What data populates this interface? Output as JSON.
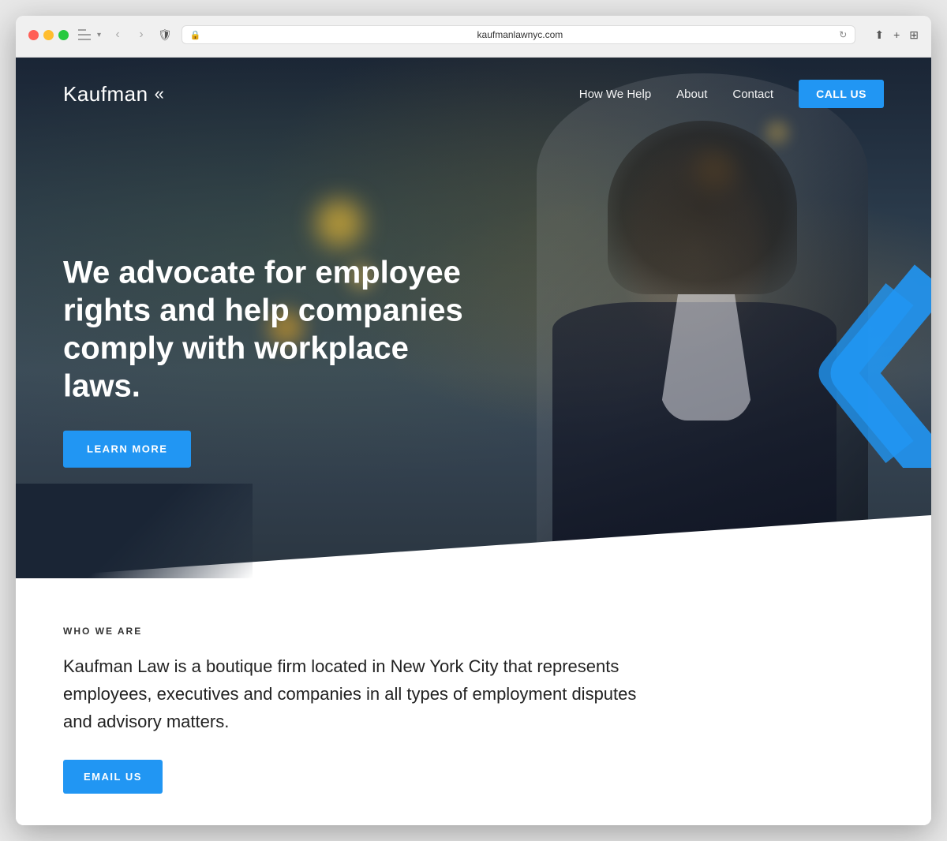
{
  "browser": {
    "url": "kaufmanlawnyc.com",
    "back_arrow": "‹",
    "forward_arrow": "›"
  },
  "nav": {
    "logo_text": "Kaufman",
    "links": [
      {
        "label": "How We Help",
        "id": "how-we-help"
      },
      {
        "label": "About",
        "id": "about"
      },
      {
        "label": "Contact",
        "id": "contact"
      }
    ],
    "cta_label": "CALL US"
  },
  "hero": {
    "headline": "We advocate for employee rights and help companies comply with workplace laws.",
    "cta_label": "LEARN MORE"
  },
  "about": {
    "section_label": "WHO WE ARE",
    "body_text": "Kaufman Law is a boutique firm located in New York City that represents employees, executives and companies in all types of employment disputes and advisory matters.",
    "cta_label": "EMAIL US"
  },
  "colors": {
    "primary_blue": "#2196F3",
    "dark_bg": "#1a2535",
    "white": "#ffffff"
  }
}
